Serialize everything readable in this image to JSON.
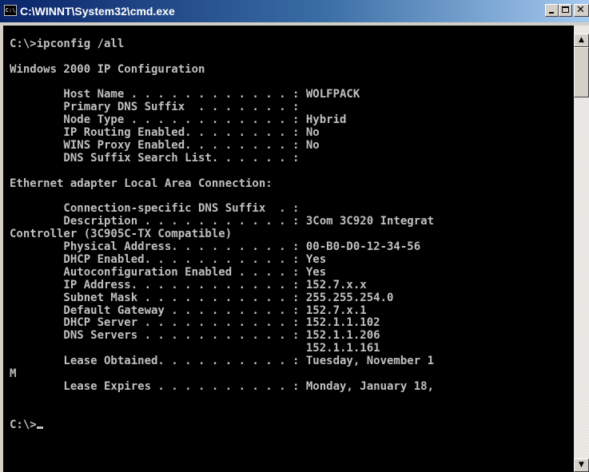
{
  "window": {
    "title": "C:\\WINNT\\System32\\cmd.exe",
    "icon": "console-icon",
    "icon_text": "C:\\",
    "minimize_icon": "minimize-icon",
    "maximize_icon": "maximize-icon",
    "close_icon": "close-icon",
    "close_glyph": "✕"
  },
  "scrollbar": {
    "up_icon": "scroll-up-arrow-icon",
    "down_icon": "scroll-down-arrow-icon",
    "up_glyph": "▲",
    "down_glyph": "▼"
  },
  "colors": {
    "console_background": "#000000",
    "console_text": "#c0c0c0",
    "titlebar_start": "#0a246a",
    "titlebar_end": "#a6caf0"
  },
  "console": {
    "lines": [
      "",
      "C:\\>ipconfig /all",
      "",
      "Windows 2000 IP Configuration",
      "",
      "        Host Name . . . . . . . . . . . . : WOLFPACK",
      "        Primary DNS Suffix  . . . . . . . :",
      "        Node Type . . . . . . . . . . . . : Hybrid",
      "        IP Routing Enabled. . . . . . . . : No",
      "        WINS Proxy Enabled. . . . . . . . : No",
      "        DNS Suffix Search List. . . . . . :",
      "",
      "Ethernet adapter Local Area Connection:",
      "",
      "        Connection-specific DNS Suffix  . :",
      "        Description . . . . . . . . . . . : 3Com 3C920 Integrat",
      "Controller (3C905C-TX Compatible)",
      "        Physical Address. . . . . . . . . : 00-B0-D0-12-34-56",
      "        DHCP Enabled. . . . . . . . . . . : Yes",
      "        Autoconfiguration Enabled . . . . : Yes",
      "        IP Address. . . . . . . . . . . . : 152.7.x.x",
      "        Subnet Mask . . . . . . . . . . . : 255.255.254.0",
      "        Default Gateway . . . . . . . . . : 152.7.x.1",
      "        DHCP Server . . . . . . . . . . . : 152.1.1.102",
      "        DNS Servers . . . . . . . . . . . : 152.1.1.206",
      "                                            152.1.1.161",
      "        Lease Obtained. . . . . . . . . . : Tuesday, November 1",
      "M",
      "        Lease Expires . . . . . . . . . . : Monday, January 18,",
      "",
      "",
      "C:\\>"
    ]
  }
}
